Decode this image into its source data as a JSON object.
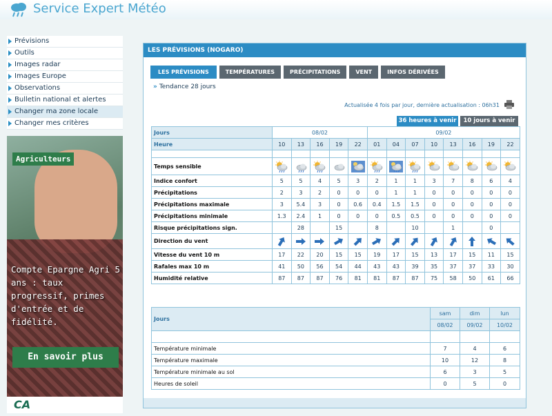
{
  "app": {
    "title": "Service Expert Météo"
  },
  "sidebar": {
    "items": [
      {
        "label": "Prévisions",
        "active": false
      },
      {
        "label": "Outils",
        "active": false
      },
      {
        "label": "Images radar",
        "active": false
      },
      {
        "label": "Images Europe",
        "active": false
      },
      {
        "label": "Observations",
        "active": false
      },
      {
        "label": "Bulletin national et alertes",
        "active": false
      },
      {
        "label": "Changer ma zone locale",
        "active": true
      },
      {
        "label": "Changer mes critères",
        "active": false
      }
    ]
  },
  "ad": {
    "badge": "Agriculteurs",
    "text": "Compte Epargne Agri 5 ans : taux progressif, primes d'entrée et de fidélité.",
    "cta": "En savoir plus",
    "logo": "CA"
  },
  "panel": {
    "title": "LES PRÉVISIONS (NOGARO)",
    "tabs": [
      "LES PRÉVISIONS",
      "TEMPÉRATURES",
      "PRÉCIPITATIONS",
      "VENT",
      "INFOS DÉRIVÉES"
    ],
    "active_tab": 0,
    "tendance": "Tendance 28 jours",
    "update_text": "Actualisée 4 fois par jour, dernière actualisation : 06h31",
    "range_36": "36 heures à venir",
    "range_10": "10 jours à venir"
  },
  "hourly": {
    "jours_label": "Jours",
    "heure_label": "Heure",
    "days": [
      {
        "label": "08/02",
        "span": 5
      },
      {
        "label": "09/02",
        "span": 8
      }
    ],
    "hours": [
      "10",
      "13",
      "16",
      "19",
      "22",
      "01",
      "04",
      "07",
      "10",
      "13",
      "16",
      "19",
      "22"
    ],
    "weather_icons": [
      "sun-cloud-rain",
      "cloud-rain",
      "sun-cloud-rain",
      "cloud",
      "night-cloud",
      "sun-cloud-rain",
      "night-cloud-rain",
      "sun-cloud-rain",
      "sun-cloud",
      "sun-cloud",
      "sun-cloud",
      "sun-cloud",
      "sun-cloud"
    ],
    "rows": [
      {
        "label": "Temps sensible",
        "type": "icons"
      },
      {
        "label": "Indice confort",
        "values": [
          "5",
          "5",
          "4",
          "5",
          "3",
          "2",
          "1",
          "1",
          "3",
          "7",
          "8",
          "6",
          "4"
        ]
      },
      {
        "label": "Précipitations",
        "values": [
          "2",
          "3",
          "2",
          "0",
          "0",
          "0",
          "1",
          "1",
          "0",
          "0",
          "0",
          "0",
          "0"
        ]
      },
      {
        "label": "Précipitations maximale",
        "values": [
          "3",
          "5.4",
          "3",
          "0",
          "0.6",
          "0.4",
          "1.5",
          "1.5",
          "0",
          "0",
          "0",
          "0",
          "0"
        ]
      },
      {
        "label": "Précipitations minimale",
        "values": [
          "1.3",
          "2.4",
          "1",
          "0",
          "0",
          "0",
          "0.5",
          "0.5",
          "0",
          "0",
          "0",
          "0",
          "0"
        ]
      },
      {
        "label": "Risque précipitations sign.",
        "values": [
          "",
          "28",
          "",
          "15",
          "",
          "8",
          "",
          "10",
          "",
          "1",
          "",
          "0",
          ""
        ]
      },
      {
        "label": "Direction du vent",
        "type": "wind",
        "wind_angles": [
          30,
          90,
          90,
          60,
          45,
          60,
          45,
          40,
          30,
          30,
          0,
          -60,
          -50
        ]
      },
      {
        "label": "Vitesse du vent 10 m",
        "values": [
          "17",
          "22",
          "20",
          "15",
          "15",
          "19",
          "17",
          "15",
          "13",
          "17",
          "15",
          "11",
          "15"
        ]
      },
      {
        "label": "Rafales max 10 m",
        "values": [
          "41",
          "50",
          "56",
          "54",
          "44",
          "43",
          "43",
          "39",
          "35",
          "37",
          "37",
          "33",
          "30"
        ]
      },
      {
        "label": "Humidité relative",
        "values": [
          "87",
          "87",
          "87",
          "76",
          "81",
          "81",
          "87",
          "87",
          "75",
          "58",
          "50",
          "61",
          "66"
        ]
      }
    ]
  },
  "daily": {
    "jours_label": "Jours",
    "days": [
      {
        "name": "sam",
        "date": "08/02"
      },
      {
        "name": "dim",
        "date": "09/02"
      },
      {
        "name": "lun",
        "date": "10/02"
      }
    ],
    "rows": [
      {
        "label": "Température minimale",
        "values": [
          "7",
          "4",
          "6"
        ]
      },
      {
        "label": "Température maximale",
        "values": [
          "10",
          "12",
          "8"
        ]
      },
      {
        "label": "Température minimale au sol",
        "values": [
          "6",
          "3",
          "5"
        ]
      },
      {
        "label": "Heures de soleil",
        "values": [
          "0",
          "5",
          "0"
        ]
      }
    ]
  },
  "colors": {
    "accent": "#2c8cc4",
    "tab_inactive": "#5b6770",
    "border": "#8fc3dc",
    "header_cell": "#dcebf3"
  }
}
